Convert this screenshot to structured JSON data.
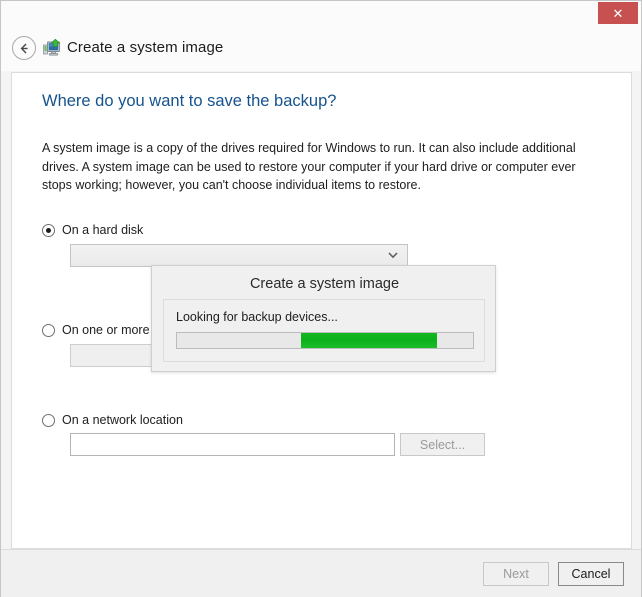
{
  "window": {
    "close_label": "✕"
  },
  "header": {
    "title": "Create a system image",
    "back_icon": "back-arrow-icon",
    "app_icon": "system-image-backup-icon"
  },
  "page": {
    "heading": "Where do you want to save the backup?",
    "description": "A system image is a copy of the drives required for Windows to run. It can also include additional drives. A system image can be used to restore your computer if your hard drive or computer ever stops working; however, you can't choose individual items to restore."
  },
  "options": [
    {
      "id": "hard-disk",
      "label": "On a hard disk",
      "selected": true,
      "control": "dropdown",
      "value": "",
      "disabled": true
    },
    {
      "id": "dvds",
      "label": "On one or more",
      "selected": false,
      "control": "dropdown",
      "value": "",
      "disabled": true
    },
    {
      "id": "network",
      "label": "On a network location",
      "selected": false,
      "control": "textbox",
      "value": "",
      "disabled": false,
      "button_label": "Select...",
      "button_disabled": true
    }
  ],
  "footer": {
    "next_label": "Next",
    "next_disabled": true,
    "cancel_label": "Cancel",
    "cancel_disabled": false
  },
  "overlay": {
    "title": "Create a system image",
    "status": "Looking for backup devices...",
    "progress": {
      "mode": "marquee",
      "chunk_start_percent": 42,
      "chunk_width_percent": 46,
      "color": "#0bb01a"
    }
  },
  "colors": {
    "close_button": "#c75050",
    "heading": "#16538d",
    "progress_green": "#0bb01a",
    "window_chrome": "#f0f0f0"
  }
}
